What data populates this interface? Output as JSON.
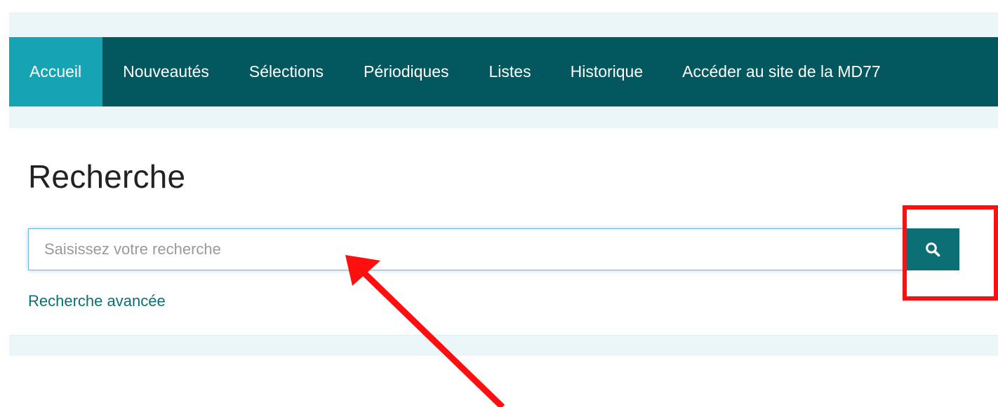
{
  "nav": {
    "items": [
      {
        "label": "Accueil",
        "active": true
      },
      {
        "label": "Nouveautés",
        "active": false
      },
      {
        "label": "Sélections",
        "active": false
      },
      {
        "label": "Périodiques",
        "active": false
      },
      {
        "label": "Listes",
        "active": false
      },
      {
        "label": "Historique",
        "active": false
      },
      {
        "label": "Accéder au site de la MD77",
        "active": false
      }
    ]
  },
  "search": {
    "title": "Recherche",
    "placeholder": "Saisissez votre recherche",
    "value": "",
    "button_icon": "search-icon",
    "advanced_link": "Recherche avancée"
  },
  "annotations": {
    "highlight_color": "#ff0f0f",
    "arrow_color": "#ff0f0f",
    "highlight_target": "search-button",
    "arrow_target": "search-input"
  },
  "colors": {
    "navbar": "#03575e",
    "nav_active": "#16a4b4",
    "accent": "#0d6f76",
    "band": "#eaf6f8"
  }
}
